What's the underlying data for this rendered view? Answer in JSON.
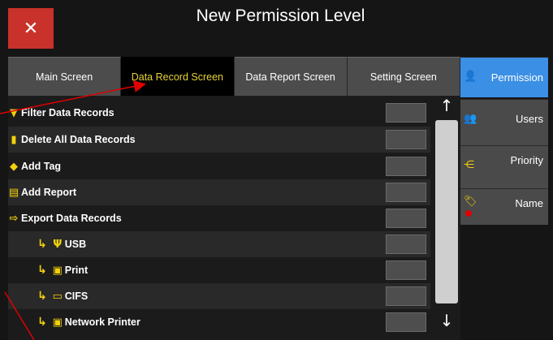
{
  "window": {
    "title": "New Permission Level",
    "close_glyph": "✕"
  },
  "tabs": [
    {
      "label": "Main Screen",
      "active": false
    },
    {
      "label": "Data Record Screen",
      "active": true
    },
    {
      "label": "Data Report Screen",
      "active": false
    },
    {
      "label": "Setting Screen",
      "active": false
    }
  ],
  "sidebar": {
    "items": [
      {
        "label": "Permission",
        "icon": "user-check-icon",
        "active": true
      },
      {
        "label": "Users",
        "icon": "users-icon",
        "active": false
      },
      {
        "label": "Priority",
        "icon": "priority-list-icon",
        "active": false
      },
      {
        "label": "Name",
        "icon": "name-tag-icon",
        "active": false
      }
    ]
  },
  "permissions": [
    {
      "label": "Filter Data Records",
      "icon": "filter-icon",
      "sub": false
    },
    {
      "label": "Delete All Data Records",
      "icon": "trash-icon",
      "sub": false
    },
    {
      "label": "Add Tag",
      "icon": "tag-icon",
      "sub": false
    },
    {
      "label": "Add Report",
      "icon": "report-icon",
      "sub": false
    },
    {
      "label": "Export Data Records",
      "icon": "export-icon",
      "sub": false
    },
    {
      "label": "USB",
      "icon": "usb-icon",
      "sub": true
    },
    {
      "label": "Print",
      "icon": "printer-icon",
      "sub": true
    },
    {
      "label": "CIFS",
      "icon": "network-share-icon",
      "sub": true
    },
    {
      "label": "Network Printer",
      "icon": "network-printer-icon",
      "sub": true
    }
  ],
  "scrollbar": {
    "up_glyph": "↑",
    "down_glyph": "↓"
  },
  "colors": {
    "accent_yellow": "#f2d10b",
    "active_blue": "#3b8fe4",
    "close_red": "#c8322a",
    "annotation_red": "#e00000"
  }
}
